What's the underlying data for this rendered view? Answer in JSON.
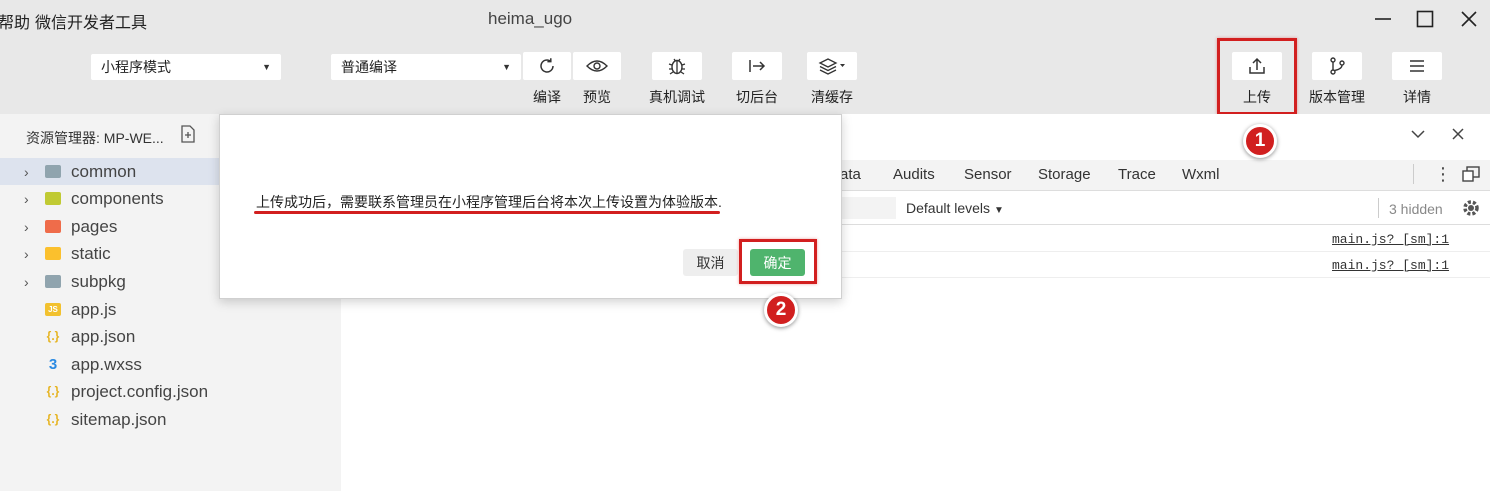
{
  "menu": {
    "help": "帮助",
    "tools": "微信开发者工具"
  },
  "window": {
    "title": "heima_ugo"
  },
  "toolbar": {
    "mode_select": "小程序模式",
    "compile_select": "普通编译",
    "compile": "编译",
    "preview": "预览",
    "device_debug": "真机调试",
    "background": "切后台",
    "clear_cache": "清缓存",
    "upload": "上传",
    "version_mgmt": "版本管理",
    "details": "详情"
  },
  "sidebar": {
    "title": "资源管理器: MP-WE...",
    "items": [
      {
        "label": "common",
        "type": "folder",
        "color": "#90a4ae"
      },
      {
        "label": "components",
        "type": "folder",
        "color": "#c0ca33"
      },
      {
        "label": "pages",
        "type": "folder",
        "color": "#ef6c4a"
      },
      {
        "label": "static",
        "type": "folder",
        "color": "#fbc02d"
      },
      {
        "label": "subpkg",
        "type": "folder",
        "color": "#90a4ae"
      },
      {
        "label": "app.js",
        "type": "js"
      },
      {
        "label": "app.json",
        "type": "json"
      },
      {
        "label": "app.wxss",
        "type": "css"
      },
      {
        "label": "project.config.json",
        "type": "json"
      },
      {
        "label": "sitemap.json",
        "type": "json"
      }
    ]
  },
  "devtools": {
    "tabs": [
      "ata",
      "Audits",
      "Sensor",
      "Storage",
      "Trace",
      "Wxml"
    ],
    "levels": "Default levels",
    "hidden": "3 hidden",
    "logs": [
      "main.js? [sm]:1",
      "main.js? [sm]:1"
    ]
  },
  "dialog": {
    "message": "上传成功后，需要联系管理员在小程序管理后台将本次上传设置为体验版本.",
    "cancel": "取消",
    "confirm": "确定"
  },
  "annotations": {
    "step1": "1",
    "step2": "2",
    "color": "#d21f1f"
  }
}
